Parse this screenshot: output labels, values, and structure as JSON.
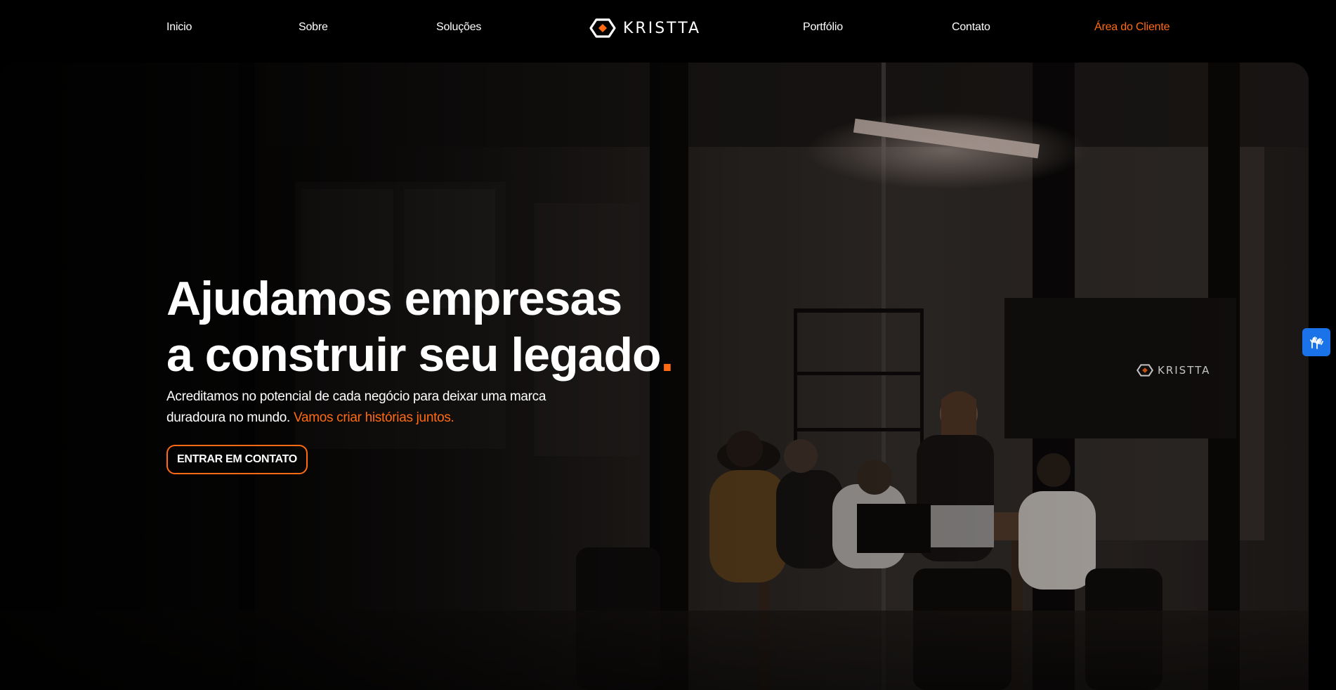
{
  "nav": {
    "items": [
      {
        "label": "Inicio"
      },
      {
        "label": "Sobre"
      },
      {
        "label": "Soluções"
      },
      {
        "label": "Portfólio"
      },
      {
        "label": "Contato"
      },
      {
        "label": "Área do Cliente"
      }
    ],
    "logo_text": "KRISTTA"
  },
  "hero": {
    "title_line1": "Ajudamos empresas",
    "title_line2": "a construir seu legado",
    "title_dot": ".",
    "subtitle_main": "Acreditamos no potencial de cada negócio para deixar uma marca duradoura no mundo.",
    "subtitle_accent": "Vamos criar histórias juntos.",
    "cta_label": "ENTRAR EM CONTATO",
    "wall_logo_text": "KRISTTA"
  },
  "colors": {
    "accent": "#ff6a13",
    "background": "#000000",
    "accessibility_button": "#1a73e8"
  },
  "icons": {
    "logo": "kristta-logo-icon",
    "accessibility": "sign-language-hands-icon"
  }
}
